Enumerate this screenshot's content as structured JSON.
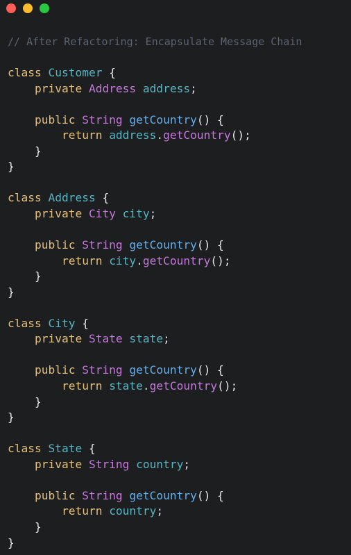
{
  "window": {
    "controls": [
      {
        "name": "close-button",
        "color": "#ff5f57"
      },
      {
        "name": "minimize-button",
        "color": "#febc2e"
      },
      {
        "name": "maximize-button",
        "color": "#28c840"
      }
    ]
  },
  "theme": {
    "comment": "#5c6370",
    "keyword": "#e5c07b",
    "type": "#c678dd",
    "identifier": "#56b6c2",
    "method": "#61afef",
    "punct": "#d7dae0",
    "brace": "#e8e8e8"
  },
  "code": {
    "lines": [
      [
        {
          "t": "// After Refactoring: Encapsulate Message Chain",
          "k": "comment"
        }
      ],
      [],
      [
        {
          "t": "class ",
          "k": "keyword"
        },
        {
          "t": "Customer",
          "k": "identifier"
        },
        {
          "t": " {",
          "k": "brace"
        }
      ],
      [
        {
          "t": "    private ",
          "k": "keyword"
        },
        {
          "t": "Address",
          "k": "type"
        },
        {
          "t": " address",
          "k": "identifier"
        },
        {
          "t": ";",
          "k": "punct"
        }
      ],
      [],
      [
        {
          "t": "    public ",
          "k": "keyword"
        },
        {
          "t": "String",
          "k": "type"
        },
        {
          "t": " getCountry",
          "k": "method"
        },
        {
          "t": "() {",
          "k": "brace"
        }
      ],
      [
        {
          "t": "        return ",
          "k": "keyword"
        },
        {
          "t": "address",
          "k": "identifier"
        },
        {
          "t": ".",
          "k": "punct"
        },
        {
          "t": "getCountry",
          "k": "type"
        },
        {
          "t": "();",
          "k": "brace"
        }
      ],
      [
        {
          "t": "    }",
          "k": "brace"
        }
      ],
      [
        {
          "t": "}",
          "k": "brace"
        }
      ],
      [],
      [
        {
          "t": "class ",
          "k": "keyword"
        },
        {
          "t": "Address",
          "k": "identifier"
        },
        {
          "t": " {",
          "k": "brace"
        }
      ],
      [
        {
          "t": "    private ",
          "k": "keyword"
        },
        {
          "t": "City",
          "k": "type"
        },
        {
          "t": " city",
          "k": "identifier"
        },
        {
          "t": ";",
          "k": "punct"
        }
      ],
      [],
      [
        {
          "t": "    public ",
          "k": "keyword"
        },
        {
          "t": "String",
          "k": "type"
        },
        {
          "t": " getCountry",
          "k": "method"
        },
        {
          "t": "() {",
          "k": "brace"
        }
      ],
      [
        {
          "t": "        return ",
          "k": "keyword"
        },
        {
          "t": "city",
          "k": "identifier"
        },
        {
          "t": ".",
          "k": "punct"
        },
        {
          "t": "getCountry",
          "k": "type"
        },
        {
          "t": "();",
          "k": "brace"
        }
      ],
      [
        {
          "t": "    }",
          "k": "brace"
        }
      ],
      [
        {
          "t": "}",
          "k": "brace"
        }
      ],
      [],
      [
        {
          "t": "class ",
          "k": "keyword"
        },
        {
          "t": "City",
          "k": "identifier"
        },
        {
          "t": " {",
          "k": "brace"
        }
      ],
      [
        {
          "t": "    private ",
          "k": "keyword"
        },
        {
          "t": "State",
          "k": "type"
        },
        {
          "t": " state",
          "k": "identifier"
        },
        {
          "t": ";",
          "k": "punct"
        }
      ],
      [],
      [
        {
          "t": "    public ",
          "k": "keyword"
        },
        {
          "t": "String",
          "k": "type"
        },
        {
          "t": " getCountry",
          "k": "method"
        },
        {
          "t": "() {",
          "k": "brace"
        }
      ],
      [
        {
          "t": "        return ",
          "k": "keyword"
        },
        {
          "t": "state",
          "k": "identifier"
        },
        {
          "t": ".",
          "k": "punct"
        },
        {
          "t": "getCountry",
          "k": "type"
        },
        {
          "t": "();",
          "k": "brace"
        }
      ],
      [
        {
          "t": "    }",
          "k": "brace"
        }
      ],
      [
        {
          "t": "}",
          "k": "brace"
        }
      ],
      [],
      [
        {
          "t": "class ",
          "k": "keyword"
        },
        {
          "t": "State",
          "k": "identifier"
        },
        {
          "t": " {",
          "k": "brace"
        }
      ],
      [
        {
          "t": "    private ",
          "k": "keyword"
        },
        {
          "t": "String",
          "k": "type"
        },
        {
          "t": " country",
          "k": "identifier"
        },
        {
          "t": ";",
          "k": "punct"
        }
      ],
      [],
      [
        {
          "t": "    public ",
          "k": "keyword"
        },
        {
          "t": "String",
          "k": "type"
        },
        {
          "t": " getCountry",
          "k": "method"
        },
        {
          "t": "() {",
          "k": "brace"
        }
      ],
      [
        {
          "t": "        return ",
          "k": "keyword"
        },
        {
          "t": "country",
          "k": "identifier"
        },
        {
          "t": ";",
          "k": "punct"
        }
      ],
      [
        {
          "t": "    }",
          "k": "brace"
        }
      ],
      [
        {
          "t": "}",
          "k": "brace"
        }
      ]
    ]
  }
}
